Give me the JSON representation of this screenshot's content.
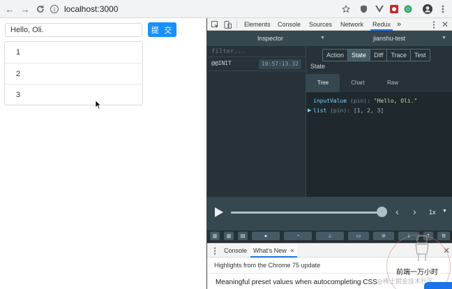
{
  "browser": {
    "url": "localhost:3000",
    "nav": [
      "back-icon",
      "forward-icon",
      "reload-icon"
    ],
    "extensions": [
      "star-icon",
      "shield-icon",
      "vue-icon",
      "record-icon",
      "chrome-icon",
      "avatar",
      "more-icon"
    ]
  },
  "page": {
    "input_value": "Hello, Oli.",
    "submit_label": "提 交",
    "list": [
      "1",
      "2",
      "3"
    ],
    "accent_color": "#1890ff"
  },
  "devtools": {
    "tabs": [
      "Elements",
      "Console",
      "Sources",
      "Network",
      "Redux"
    ],
    "active_tab": "Redux",
    "more_tabs": "»"
  },
  "redux": {
    "monitor_select": "Inspector",
    "store_select": "jianshu-test",
    "filter_placeholder": "filter...",
    "action_name": "@@INIT",
    "action_time": "10:57:13.32",
    "detail_tabs": [
      "Action",
      "State",
      "Diff",
      "Trace",
      "Test"
    ],
    "active_detail_tab": "State",
    "state_title": "State",
    "view_tabs": [
      "Tree",
      "Chart",
      "Raw"
    ],
    "active_view_tab": "Tree",
    "tree": {
      "input_key": "inputValue",
      "input_meta": "(pin):",
      "input_val": "\"Hello, Oli.\"",
      "list_key": "list",
      "list_meta": "(pin):",
      "list_val": "[1, 2, 3]"
    },
    "player": {
      "progress": 1.0,
      "speed": "1x"
    }
  },
  "drawer": {
    "tabs": [
      "Console",
      "What's New"
    ],
    "active_tab": "What's New",
    "close_tab_glyph": "×",
    "highlight": "Highlights from the Chrome 75 update",
    "feature": "Meaningful preset values when autocompleting CSS"
  },
  "watermark": {
    "big": "前端一万小时",
    "small": "@稀土掘金技术社区"
  }
}
